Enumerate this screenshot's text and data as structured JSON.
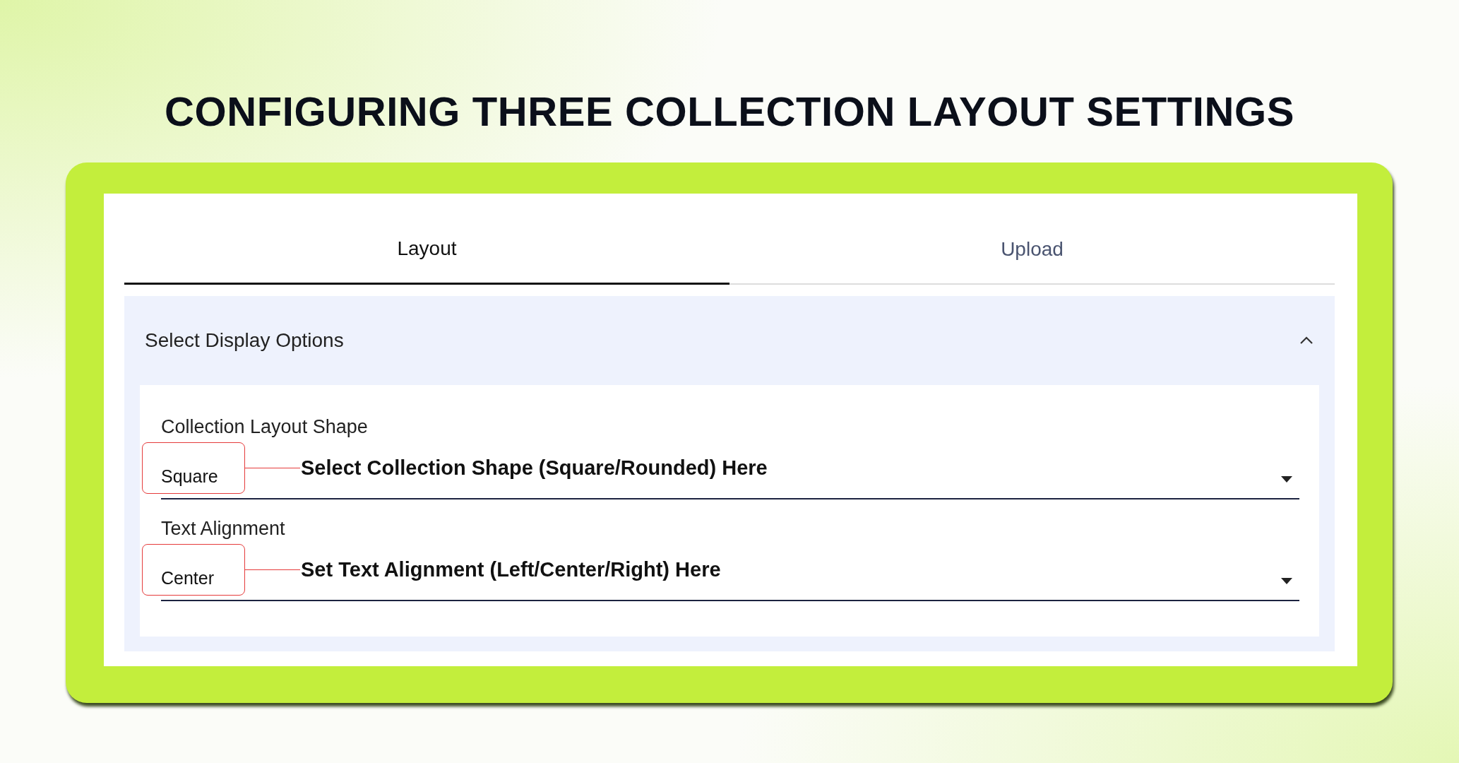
{
  "title": "CONFIGURING THREE COLLECTION LAYOUT SETTINGS",
  "tabs": [
    {
      "label": "Layout",
      "selected": true
    },
    {
      "label": "Upload",
      "selected": false
    }
  ],
  "panel": {
    "title": "Select Display Options",
    "expanded": true,
    "fields": [
      {
        "label": "Collection Layout Shape",
        "value": "Square",
        "annotation": "Select Collection Shape (Square/Rounded) Here"
      },
      {
        "label": "Text Alignment",
        "value": "Center",
        "annotation": "Set Text Alignment (Left/Center/Right) Here"
      }
    ]
  }
}
